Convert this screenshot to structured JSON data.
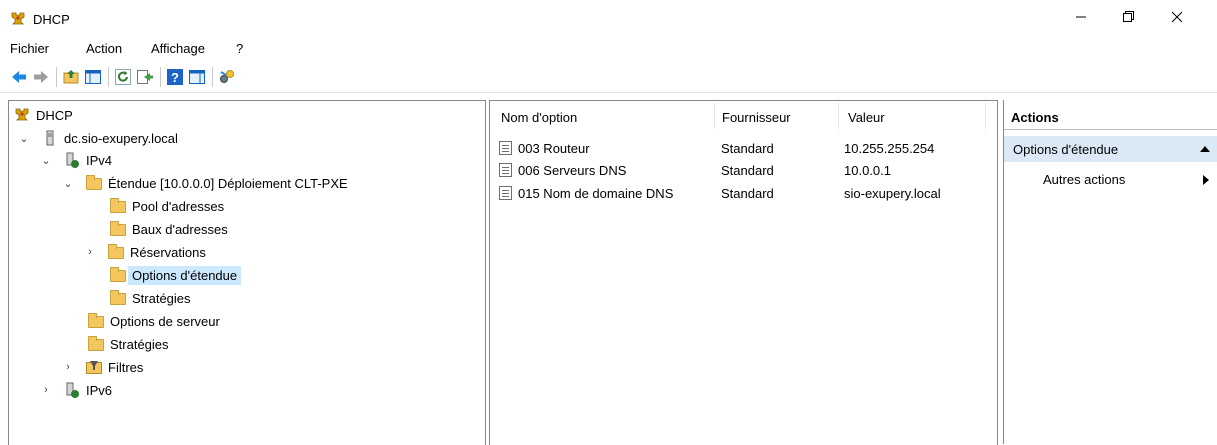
{
  "window": {
    "title": "DHCP"
  },
  "menu": [
    {
      "label": "Fichier"
    },
    {
      "label": "Action"
    },
    {
      "label": "Affichage"
    },
    {
      "label": "?"
    }
  ],
  "tree": {
    "root": "DHCP",
    "server": "dc.sio-exupery.local",
    "ipv4": "IPv4",
    "scope": "Étendue [10.0.0.0] Déploiement CLT-PXE",
    "pool": "Pool d'adresses",
    "leases": "Baux d'adresses",
    "reservations": "Réservations",
    "scope_options": "Options d'étendue",
    "scope_policies": "Stratégies",
    "server_options": "Options de serveur",
    "policies": "Stratégies",
    "filters": "Filtres",
    "ipv6": "IPv6"
  },
  "list": {
    "headers": {
      "name": "Nom d'option",
      "vendor": "Fournisseur",
      "value": "Valeur"
    },
    "rows": [
      {
        "name": "003 Routeur",
        "vendor": "Standard",
        "value": "10.255.255.254"
      },
      {
        "name": "006 Serveurs DNS",
        "vendor": "Standard",
        "value": "10.0.0.1"
      },
      {
        "name": "015 Nom de domaine DNS",
        "vendor": "Standard",
        "value": "sio-exupery.local"
      }
    ]
  },
  "actions": {
    "header": "Actions",
    "section": "Options d'étendue",
    "more": "Autres actions"
  },
  "colors": {
    "selection": "#cce8ff",
    "actions_section_bg": "#dbe9f6",
    "folder": "#f3c75d"
  }
}
